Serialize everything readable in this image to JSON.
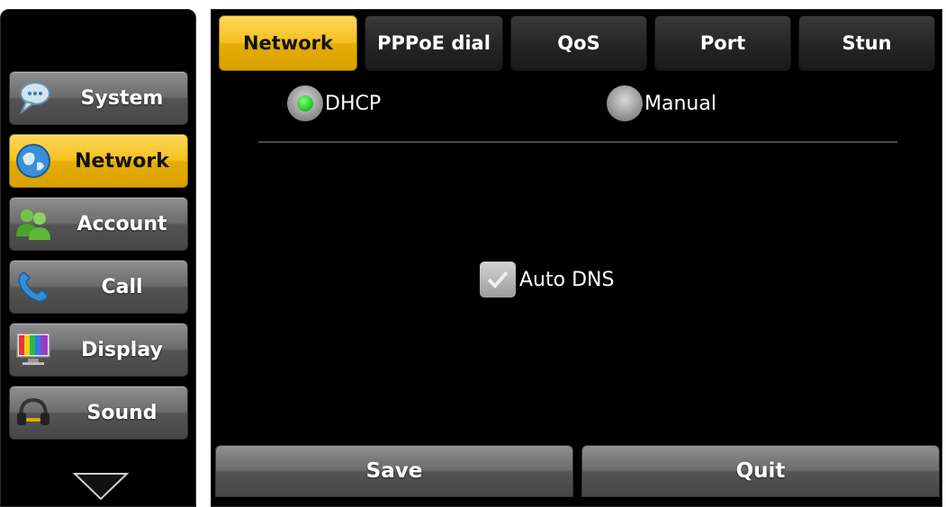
{
  "sidebar": {
    "items": [
      {
        "label": "System",
        "icon": "chat-bubble-icon",
        "active": false
      },
      {
        "label": "Network",
        "icon": "globe-icon",
        "active": true
      },
      {
        "label": "Account",
        "icon": "users-icon",
        "active": false
      },
      {
        "label": "Call",
        "icon": "phone-handset-icon",
        "active": false
      },
      {
        "label": "Display",
        "icon": "monitor-color-bars-icon",
        "active": false
      },
      {
        "label": "Sound",
        "icon": "headset-icon",
        "active": false
      }
    ],
    "more_icon": "chevron-down-icon"
  },
  "tabs": [
    {
      "label": "Network",
      "active": true
    },
    {
      "label": "PPPoE dial",
      "active": false
    },
    {
      "label": "QoS",
      "active": false
    },
    {
      "label": "Port",
      "active": false
    },
    {
      "label": "Stun",
      "active": false
    }
  ],
  "ip_mode": {
    "options": [
      {
        "label": "DHCP",
        "selected": true
      },
      {
        "label": "Manual",
        "selected": false
      }
    ]
  },
  "auto_dns": {
    "label": "Auto DNS",
    "checked": true
  },
  "actions": {
    "save_label": "Save",
    "quit_label": "Quit"
  },
  "colors": {
    "accent": "#f5c11e",
    "radio_on": "#1fc21f"
  }
}
